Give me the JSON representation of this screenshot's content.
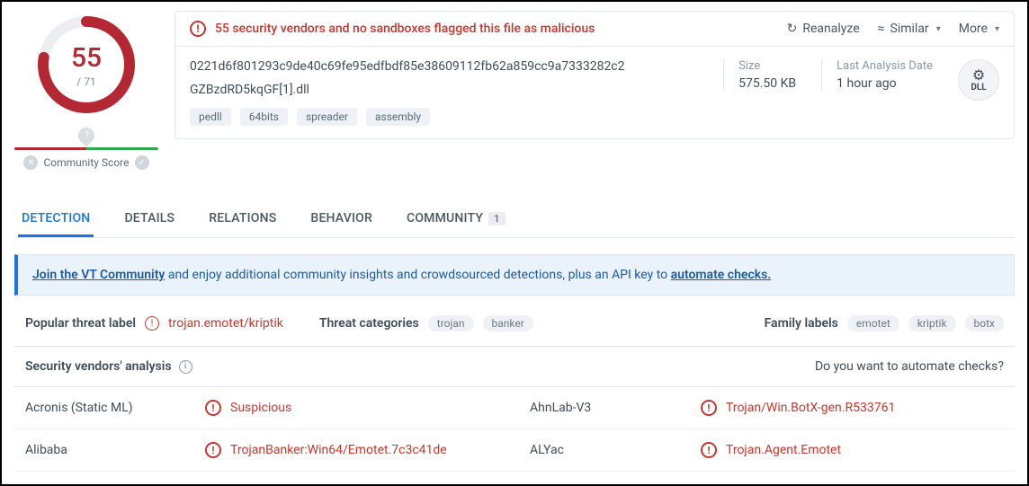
{
  "score": {
    "value": "55",
    "total": "/ 71",
    "community_label": "Community Score"
  },
  "flag_message": "55 security vendors and no sandboxes flagged this file as malicious",
  "actions": {
    "reanalyze": "Reanalyze",
    "similar": "Similar",
    "more": "More"
  },
  "file": {
    "hash": "0221d6f801293c9de40c69fe95edfbdf85e38609112fb62a859cc9a7333282c2",
    "name": "GZBzdRD5kqGF[1].dll",
    "tags": [
      "pedll",
      "64bits",
      "spreader",
      "assembly"
    ],
    "size_label": "Size",
    "size_value": "575.50 KB",
    "analysis_label": "Last Analysis Date",
    "analysis_value": "1 hour ago",
    "type_badge": "DLL"
  },
  "tabs": [
    {
      "label": "DETECTION",
      "active": true
    },
    {
      "label": "DETAILS"
    },
    {
      "label": "RELATIONS"
    },
    {
      "label": "BEHAVIOR"
    },
    {
      "label": "COMMUNITY",
      "badge": "1"
    }
  ],
  "banner": {
    "link1": "Join the VT Community",
    "mid": " and enjoy additional community insights and crowdsourced detections, plus an API key to ",
    "link2": "automate checks."
  },
  "threat": {
    "popular_label": "Popular threat label",
    "popular_value": "trojan.emotet/kriptik",
    "categories_label": "Threat categories",
    "categories": [
      "trojan",
      "banker"
    ],
    "family_label": "Family labels",
    "families": [
      "emotet",
      "kriptik",
      "botx"
    ]
  },
  "vendors_header": {
    "title": "Security vendors' analysis",
    "automate": "Do you want to automate checks?"
  },
  "vendors": [
    {
      "name": "Acronis (Static ML)",
      "result": "Suspicious"
    },
    {
      "name": "AhnLab-V3",
      "result": "Trojan/Win.BotX-gen.R533761"
    },
    {
      "name": "Alibaba",
      "result": "TrojanBanker:Win64/Emotet.7c3c41de"
    },
    {
      "name": "ALYac",
      "result": "Trojan.Agent.Emotet"
    }
  ]
}
